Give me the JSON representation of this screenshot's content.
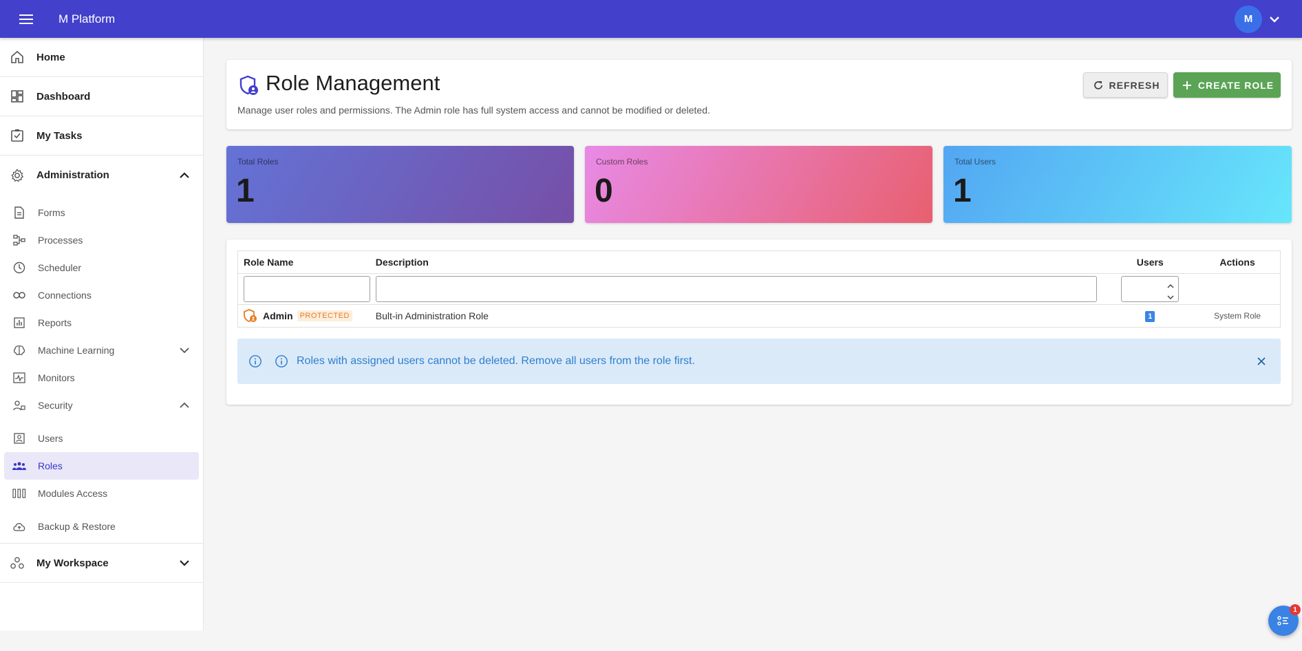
{
  "topbar": {
    "app_title": "M Platform",
    "avatar_initial": "M"
  },
  "sidebar": {
    "items": [
      {
        "label": "Home"
      },
      {
        "label": "Dashboard"
      },
      {
        "label": "My Tasks"
      },
      {
        "label": "Administration"
      },
      {
        "label": "Forms"
      },
      {
        "label": "Processes"
      },
      {
        "label": "Scheduler"
      },
      {
        "label": "Connections"
      },
      {
        "label": "Reports"
      },
      {
        "label": "Machine Learning"
      },
      {
        "label": "Monitors"
      },
      {
        "label": "Security"
      },
      {
        "label": "Users"
      },
      {
        "label": "Roles"
      },
      {
        "label": "Modules Access"
      },
      {
        "label": "Backup & Restore"
      },
      {
        "label": "My Workspace"
      }
    ],
    "active": "Roles"
  },
  "header": {
    "title": "Role Management",
    "subtitle": "Manage user roles and permissions. The Admin role has full system access and cannot be modified or deleted.",
    "refresh_label": "REFRESH",
    "create_label": "CREATE ROLE"
  },
  "stats": [
    {
      "label": "Total Roles",
      "value": "1"
    },
    {
      "label": "Custom Roles",
      "value": "0"
    },
    {
      "label": "Total Users",
      "value": "1"
    }
  ],
  "table": {
    "columns": [
      "Role Name",
      "Description",
      "Users",
      "Actions"
    ],
    "rows": [
      {
        "name": "Admin",
        "badge": "PROTECTED",
        "description": "Bult-in Administration Role",
        "users": "1",
        "action": "System Role"
      }
    ]
  },
  "alert": {
    "text": "Roles with assigned users cannot be deleted. Remove all users from the role first."
  },
  "fab": {
    "badge_count": "1"
  },
  "colors": {
    "topbar": "#4340cc",
    "accent": "#3b38c5",
    "create_button": "#5ba456",
    "alert_bg": "#dbeaf9",
    "alert_text": "#2e7fcf",
    "protected": "#e47d22"
  }
}
